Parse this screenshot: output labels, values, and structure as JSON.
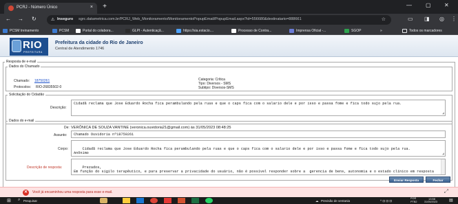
{
  "browser": {
    "tab_title": "PCRJ - Número Único",
    "tab_close": "×",
    "new_tab": "+",
    "security_label": "Inseguro",
    "url": "sgrc.datametrica.com.br/PCRJ_Web_Monitoramento/MonitoramentoPopupEmail/PopupEmail.aspx?id=556680&destinatario=888661",
    "bookmarks": [
      {
        "label": "PCSM treinamento",
        "color": "#3d7bd1"
      },
      {
        "label": "PCSM",
        "color": "#3d7bd1"
      },
      {
        "label": "Portal do colabora...",
        "color": "#ffffff"
      },
      {
        "label": "GLPI - Autenticaçã...",
        "color": "#2b2b2b"
      },
      {
        "label": "https://sia.estacio....",
        "color": "#4da3ff"
      },
      {
        "label": "Processo de Contra...",
        "color": "#ffffff"
      },
      {
        "label": "Imprensa Oficial -...",
        "color": "#6a7bd6"
      },
      {
        "label": "SGOP",
        "color": "#2ea44f"
      }
    ],
    "bookmarks_more": "»",
    "all_bookmarks": "Todos os marcadores"
  },
  "header": {
    "logo_text": "RIO",
    "logo_sub": "PREFEITURA",
    "title": "Prefeitura da cidade do Rio de Janeiro",
    "subtitle": "Central de Atendimento 1746"
  },
  "form": {
    "outer_legend": "Resposta de e-mail",
    "chamado": {
      "legend": "Dados do Chamado",
      "chamado_label": "Chamado:",
      "chamado_value": "18750261",
      "protocolo_label": "Protocolos:",
      "protocolo_value": "RIO-26835502-0",
      "categoria": "Categoria: Crítica",
      "tipo": "Tipo: Diversos - SMS",
      "subtipo": "Subtipo: Diversos-SMS"
    },
    "solicitacao": {
      "legend": "Solicitação do Cidadão",
      "descricao_label": "Descrição:",
      "descricao_text": "Cidadã reclama que Jose Eduardo Rocha fica perambulando pela ruas e que o caps fica com o salario dele e por isso e passa fome e fica todo sujo pela rua."
    },
    "email": {
      "legend": "Dados do e-mail",
      "de_label": "De:",
      "de_value": "VERÔNICA DE SOUZA VANTINE (veronica.ouvidoria21@gmail.com) às 31/05/2023 08:48:25",
      "assunto_label": "Assunto:",
      "assunto_value": "Chamado Ouvidoria nº18750261",
      "corpo_label": "Corpo:",
      "corpo_text": "Cidadã reclama que Jose Eduardo Rocha fica perambulando pela ruas e que o caps fica com o salario dele e por isso e passa fome e fica todo sujo pela rua.\nAnônimo",
      "resposta_label": "Descrição de resposta:",
      "resposta_text": "Prezados,\nEm função do sigilo terapêutico, e para preservar a privacidade do usuário, não é possível responder sobre a  gerencia de bens, autonomia e o estado clínico em resposta  à ouvidoria. Os usuários acompanhados em regime intensivo no CAPS possuem registros em prontuário para"
    },
    "buttons": {
      "send": "Enviar Resposta",
      "close": "Fechar"
    }
  },
  "error": {
    "message": "Você já encaminhou uma resposta para esse e-mail."
  },
  "taskbar": {
    "search_placeholder": "Pesquisar",
    "weather": "Previsão de ventania",
    "lang": "POR\nPTB2",
    "time": "13:58",
    "date": "31/05/2023"
  }
}
